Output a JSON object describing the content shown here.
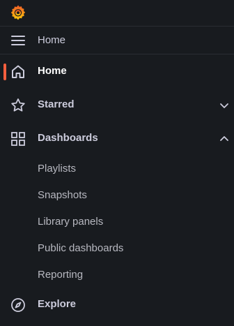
{
  "header": {
    "logo_icon": "grafana-logo-icon",
    "breadcrumb": "Home"
  },
  "nav": {
    "accent_color": "#f55f3e",
    "items": [
      {
        "label": "Home",
        "icon": "home-icon",
        "active": true
      },
      {
        "label": "Starred",
        "icon": "star-icon",
        "expander": "chevron-down-icon"
      },
      {
        "label": "Dashboards",
        "icon": "grid-icon",
        "expander": "chevron-up-icon",
        "children": [
          "Playlists",
          "Snapshots",
          "Library panels",
          "Public dashboards",
          "Reporting"
        ]
      },
      {
        "label": "Explore",
        "icon": "compass-icon"
      }
    ]
  }
}
